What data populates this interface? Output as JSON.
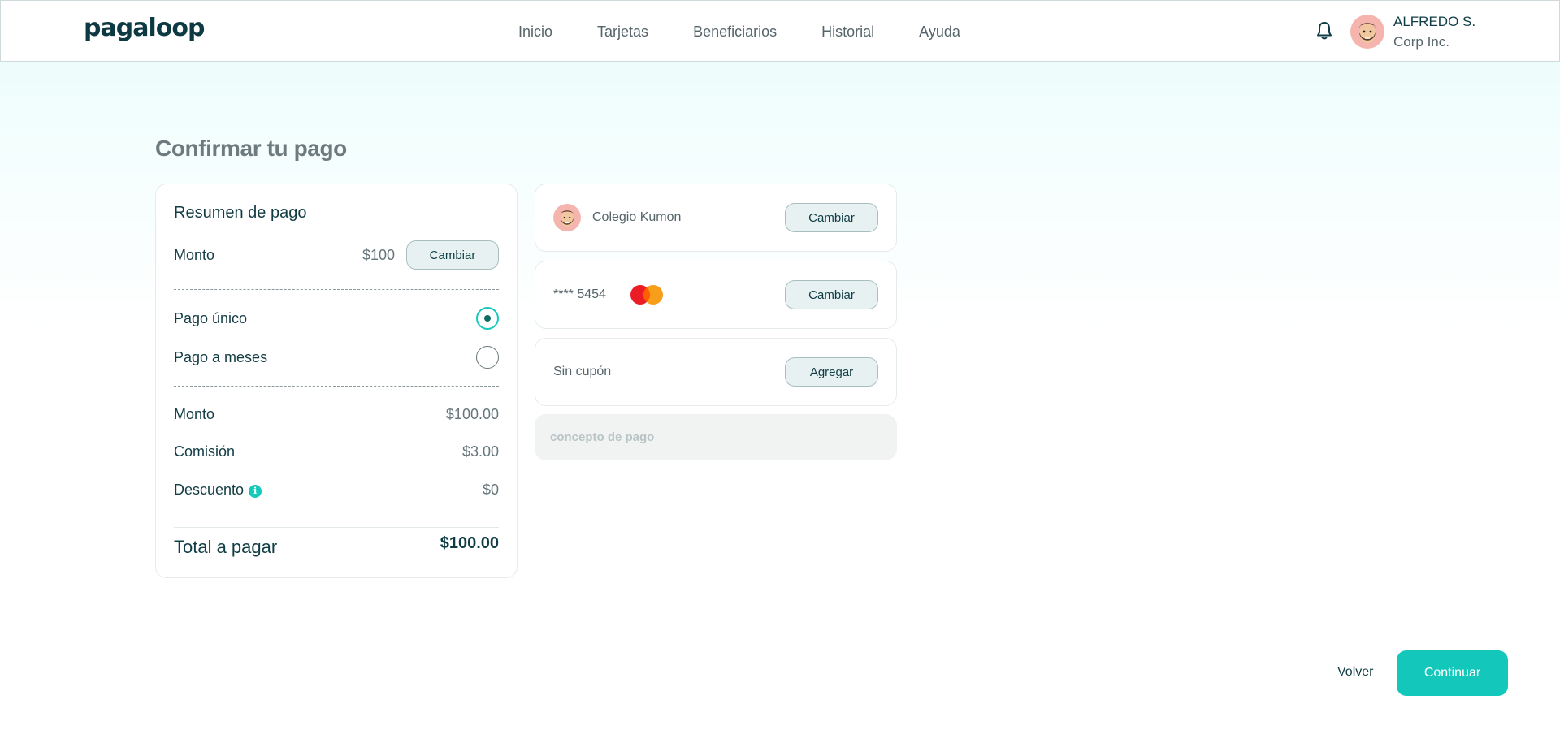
{
  "brand": {
    "logo": "pagaloop",
    "accent": "#13c8bb",
    "dark": "#0f3d45"
  },
  "nav": [
    {
      "label": "Inicio"
    },
    {
      "label": "Tarjetas"
    },
    {
      "label": "Beneficiarios"
    },
    {
      "label": "Historial"
    },
    {
      "label": "Ayuda"
    }
  ],
  "user": {
    "name": "ALFREDO S.",
    "company": "Corp Inc.",
    "avatar": "avatar-emoji",
    "notification_icon": "bell-icon"
  },
  "page": {
    "title": "Confirmar tu pago"
  },
  "summary": {
    "title": "Resumen de pago",
    "amount_label": "Monto",
    "amount_value": "$100",
    "change_label": "Cambiar",
    "options": [
      {
        "label": "Pago único",
        "selected": true
      },
      {
        "label": "Pago a meses",
        "selected": false
      }
    ],
    "lines": [
      {
        "label": "Monto",
        "value": "$100.00"
      },
      {
        "label": "Comisión",
        "value": "$3.00"
      },
      {
        "label": "Descuento",
        "value": "$0",
        "icon": "info-icon"
      }
    ],
    "total_label": "Total a pagar",
    "total_value": "$100.00"
  },
  "beneficiary": {
    "name": "Colegio Kumon",
    "button": "Cambiar"
  },
  "card": {
    "number": "**** 5454",
    "brand_icon": "mastercard-icon",
    "button": "Cambiar"
  },
  "coupon": {
    "text": "Sin cupón",
    "button": "Agregar"
  },
  "concept": {
    "placeholder": "concepto de pago",
    "value": ""
  },
  "footer": {
    "back_label": "Volver",
    "continue_label": "Continuar"
  }
}
